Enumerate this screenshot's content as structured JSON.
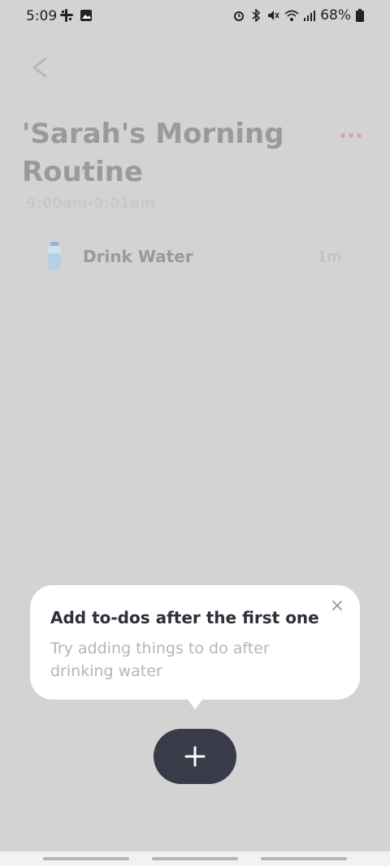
{
  "status_bar": {
    "time": "5:09",
    "battery": "68%",
    "left_icons": [
      "slack-icon",
      "image-icon"
    ],
    "right_icons": [
      "alarm-icon",
      "bluetooth-icon",
      "mute-icon",
      "wifi-icon",
      "signal-icon",
      "battery-icon"
    ]
  },
  "header": {
    "back_label": "<",
    "title": "'Sarah's Morning Routine",
    "time_range": "9:00am-9:01am"
  },
  "todos": [
    {
      "title": "Drink Water",
      "duration": "1m",
      "icon": "water-bottle-icon"
    }
  ],
  "tooltip": {
    "title": "Add to-dos after the first one",
    "body": "Try adding things to do after drinking water",
    "close_label": "×"
  },
  "fab": {
    "icon": "plus-icon"
  },
  "colors": {
    "background": "#d3d3d3",
    "fab": "#3a3b48",
    "accent_dots": "#d9a6a6"
  }
}
